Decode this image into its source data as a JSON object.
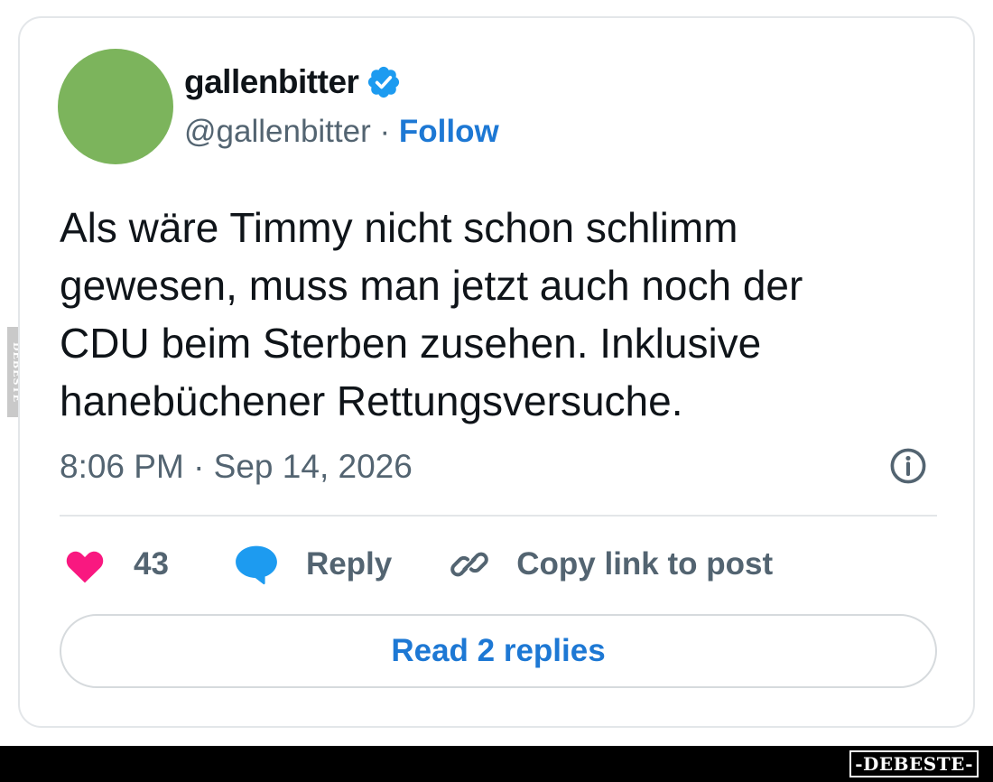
{
  "author": {
    "name": "gallenbitter",
    "handle": "@gallenbitter",
    "separator": "·",
    "follow_label": "Follow",
    "avatar_color": "#7cb45c",
    "verified_icon": "verified-badge-icon"
  },
  "post": {
    "text": "Als wäre Timmy nicht schon schlimm\ngewesen, muss man jetzt auch noch der\nCDU beim Sterben zusehen. Inklusive\nhanebüchener Rettungsversuche.",
    "timestamp": "8:06 PM · Sep 14, 2026",
    "info_icon": "info-icon"
  },
  "actions": {
    "like_count": "43",
    "reply_label": "Reply",
    "copy_link_label": "Copy link to post"
  },
  "replies_button": "Read 2 replies",
  "watermark": {
    "side_text": "DEBESTE",
    "footer_text": "-DEBESTE-"
  },
  "colors": {
    "link": "#1d78d4",
    "like": "#f91880",
    "reply": "#1d9bf0",
    "muted": "#536471",
    "text": "#0f1419"
  }
}
